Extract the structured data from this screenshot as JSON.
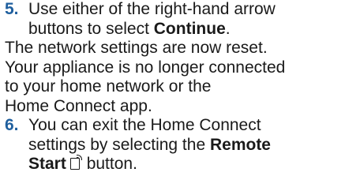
{
  "colors": {
    "step_number": "#1f5f9e",
    "text": "#1a1a1a"
  },
  "steps": [
    {
      "number": "5.",
      "line1": "Use either of the right-hand arrow",
      "line2_prefix": "buttons to select ",
      "line2_bold": "Continue",
      "line2_suffix": "."
    },
    {
      "number": "6.",
      "line1": "You can exit the Home Connect",
      "line2_prefix": "settings by selecting the ",
      "line2_bold": "Remote",
      "line3_bold": "Start",
      "line3_suffix": " button.",
      "icon": "remote-start-icon"
    }
  ],
  "paragraph": {
    "line1": "The network settings are now reset.",
    "line2": "Your appliance is no longer connected",
    "line3": "to your home network or the",
    "line4": "Home Connect app."
  }
}
